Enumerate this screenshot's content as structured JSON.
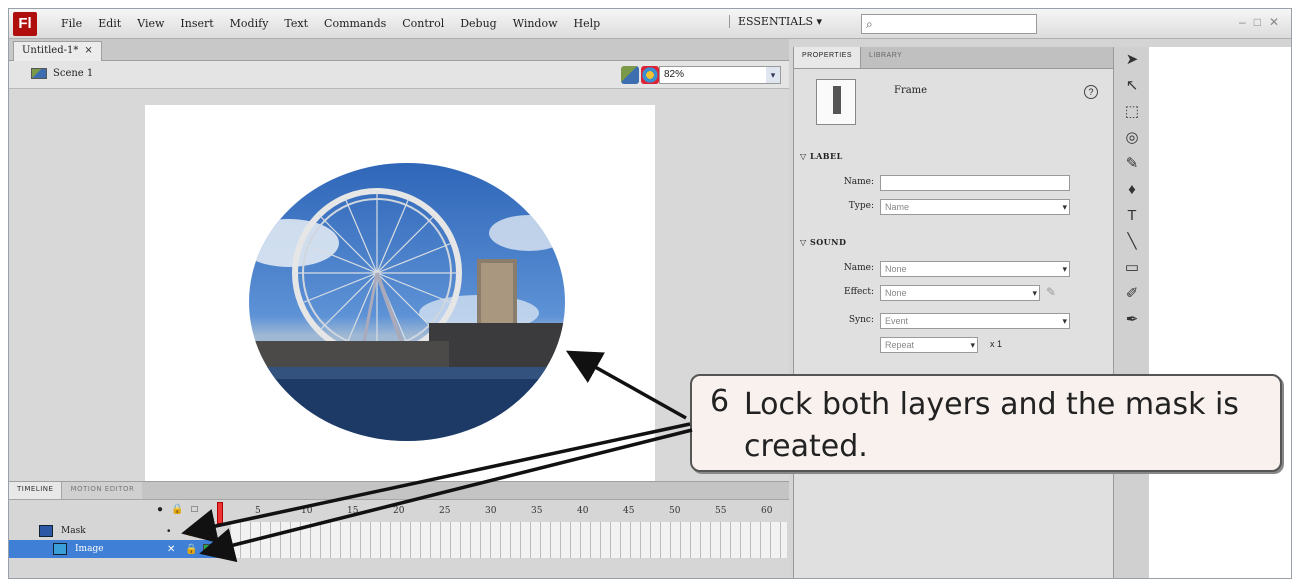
{
  "menu": {
    "logo": "Fl",
    "items": [
      "File",
      "Edit",
      "View",
      "Insert",
      "Modify",
      "Text",
      "Commands",
      "Control",
      "Debug",
      "Window",
      "Help"
    ],
    "workspace": "ESSENTIALS ▾",
    "search_icon": "search-icon",
    "window_controls": [
      "–",
      "□",
      "✕"
    ]
  },
  "document": {
    "tab_label": "Untitled-1*",
    "tab_close": "×",
    "scene_label": "Scene 1",
    "zoom": "82%"
  },
  "timeline": {
    "tabs": [
      "TIMELINE",
      "MOTION EDITOR"
    ],
    "column_icons": [
      "●",
      "🔒",
      "□"
    ],
    "frame_numbers": [
      "5",
      "10",
      "15",
      "20",
      "25",
      "30",
      "35",
      "40",
      "45",
      "50",
      "55",
      "60"
    ],
    "layers": [
      {
        "name": "Mask",
        "visibility": "•",
        "lock": "🔒",
        "selected": false
      },
      {
        "name": "Image",
        "visibility": "✕",
        "lock": "🔒",
        "selected": true
      }
    ]
  },
  "properties": {
    "tabs": [
      "PROPERTIES",
      "LIBRARY"
    ],
    "frame_label": "Frame",
    "help": "?",
    "label_section": "LABEL",
    "name_label": "Name:",
    "name_value": "",
    "type_label": "Type:",
    "type_value": "Name",
    "sound_section": "SOUND",
    "sound_name_label": "Name:",
    "sound_name_value": "None",
    "effect_label": "Effect:",
    "effect_value": "None",
    "sync_label": "Sync:",
    "sync_value": "Event",
    "repeat_value": "Repeat",
    "repeat_count": "x 1"
  },
  "tools": [
    "➤",
    "↖",
    "⬚",
    "◎",
    "✎",
    "♦",
    "T",
    "╲",
    "▭",
    "✐",
    "✒"
  ],
  "callout": {
    "number": "6",
    "text": "Lock both layers and the mask is created."
  }
}
